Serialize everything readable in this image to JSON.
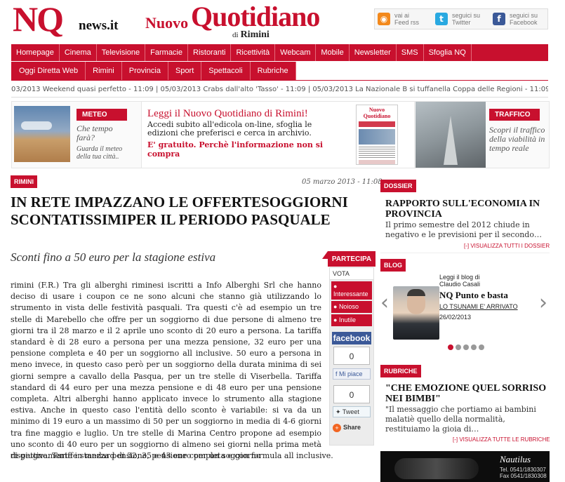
{
  "header": {
    "logo_nq": "NQ",
    "logo_news": "news.it",
    "logo_nuovo": "Nuovo",
    "logo_quotidiano": "Quotidiano",
    "logo_di": "di",
    "logo_rimini": "Rimini",
    "social": [
      {
        "icon": "rss-icon",
        "glyph": "◉",
        "line1": "vai ai",
        "line2": "Feed rss"
      },
      {
        "icon": "twitter-icon",
        "glyph": "t",
        "line1": "seguici su",
        "line2": "Twitter"
      },
      {
        "icon": "facebook-icon",
        "glyph": "f",
        "line1": "seguici su",
        "line2": "Facebook"
      }
    ]
  },
  "nav_primary": [
    "Homepage",
    "Cinema",
    "Televisione",
    "Farmacie",
    "Ristoranti",
    "Ricettività",
    "Webcam",
    "Mobile",
    "Newsletter",
    "SMS",
    "Sfoglia NQ"
  ],
  "nav_secondary": [
    "Oggi Diretta Web",
    "Rimini",
    "Provincia",
    "Sport",
    "Spettacoli",
    "Rubriche"
  ],
  "ticker": "03/2013 Weekend quasi perfetto - 11:09 | 05/03/2013 Crabs dall'alto 'Tasso' - 11:09 | 05/03/2013 La Nazionale B si tuffanella Coppa delle Regioni - 11:09 | 05/03/2",
  "promo": {
    "meteo_tag": "METEO",
    "meteo_q": "Che tempo farà?",
    "meteo_sub": "Guarda il meteo della tua città..",
    "title": "Leggi il Nuovo Quotidiano di Rimini!",
    "text": "Accedi subito all'edicola on-line, sfoglia le edizioni che preferisci e cerca in archivio.",
    "free": "E' gratuito. Perchè l'informazione non si compra",
    "paper_head": "Nuovo Quotidiano",
    "traffic_tag": "TRAFFICO",
    "traffic_text": "Scopri il traffico della viabilità in tempo reale"
  },
  "article": {
    "section": "RIMINI",
    "date": "05 marzo 2013 - 11:08",
    "title": "IN RETE IMPAZZANO LE OFFERTESOGGIORNI SCONTATISSIMIPER IL PERIODO PASQUALE",
    "subtitle": "Sconti fino a 50 euro per la stagione estiva",
    "body": "rimini (F.R.) Tra gli alberghi riminesi iscritti a Info Alberghi Srl che hanno deciso di usare i coupon ce ne sono alcuni che stanno già utilizzando lo strumento in vista delle festività pasquali. Tra questi c'è ad esempio un tre stelle di Marebello che offre per un soggiorno di due persone di almeno tre giorni tra il 28 marzo e il 2 aprile uno sconto di 20 euro a persona. La tariffa standard è di 28 euro a persona per una mezza pensione, 32 euro per una pensione completa e 40 per un soggiorno all inclusive. 50 euro a persona in meno invece, in questo caso però per un soggiorno della durata minima di sei giorni sempre a cavallo della Pasqua, per un tre stelle di Viserbella. Tariffa standard di 44 euro per una mezza pensione e di 48 euro per una pensione completa. Altri alberghi hanno applicato invece lo strumento alla stagione estiva. Anche in questo caso l'entità dello sconto è variabile: si va da un minimo di 19 euro a un massimo di 50 per un soggiorno in media di 4-6 giorni tra fine maggio e luglio. Un tre stelle di Marina Centro propone ad esempio uno sconto di 40 euro per un soggiorno di almeno sei giorni nella prima metà di giugno. Tariffe standard di 32, 35 e 43 euro per un soggiorno",
    "body_tail": "rispettivamente in mezza pensione, pensione completa e con formula all inclusive."
  },
  "partecipa": {
    "tab": "PARTECIPA",
    "vota": "VOTA",
    "votes": [
      "Interessante",
      "Noioso",
      "Inutile"
    ],
    "facebook": "facebook",
    "fb_count": "0",
    "like": "Mi piace",
    "tw_count": "0",
    "tweet": "Tweet",
    "share": "Share"
  },
  "sidebar": {
    "dossier_tag": "DOSSIER",
    "dossier_title": "RAPPORTO SULL'ECONOMIA IN PROVINCIA",
    "dossier_text": "Il primo semestre del 2012 chiude in negativo e le previsioni per il secondo…",
    "dossier_more": "VISUALIZZA TUTTI I DOSSIER",
    "blog_tag": "BLOG",
    "blog_small": "Leggi il blog di Claudio Casali",
    "blog_title": "NQ Punto e basta",
    "blog_sub": "LO TSUNAMI E' ARRIVATO",
    "blog_date": "26/02/2013",
    "rubriche_tag": "RUBRICHE",
    "rubriche_title": "\"CHE EMOZIONE QUEL SORRISO NEI BIMBI\"",
    "rubriche_text": "\"Il messaggio che portiamo ai bambini malatiè quello della normalità, restituiamo la gioia di…",
    "rubriche_more": "VISUALIZZA TUTTE LE RUBRICHE",
    "ad_brand": "Nautilus",
    "ad_tel": "Tel. 0541/1830307",
    "ad_fax": "Fax 0541/1830308"
  },
  "colors": {
    "accent": "#c8102e",
    "facebook": "#3b5998",
    "twitter": "#29a9e1",
    "rss": "#f3891c"
  }
}
